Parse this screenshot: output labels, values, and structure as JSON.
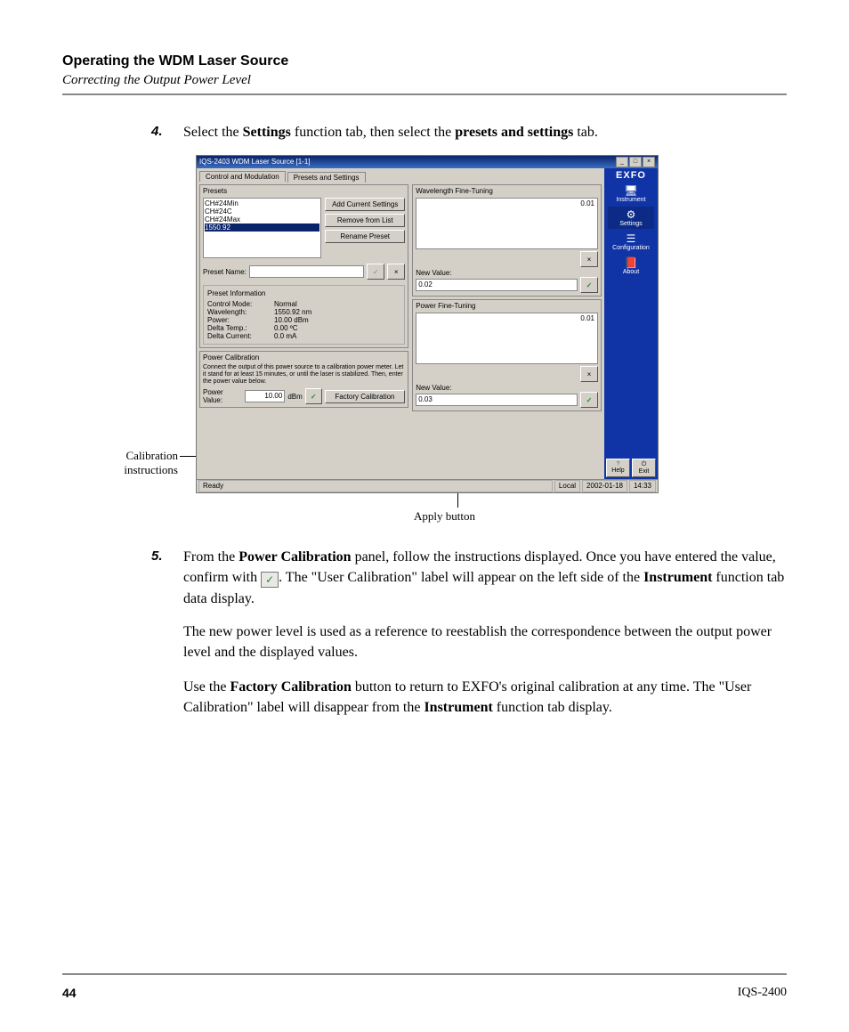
{
  "header": {
    "title": "Operating the WDM Laser Source",
    "subtitle": "Correcting the Output Power Level"
  },
  "step4": {
    "num": "4.",
    "t1": "Select the ",
    "b1": "Settings",
    "t2": " function tab, then select the ",
    "b2": "presets and settings",
    "t3": " tab."
  },
  "callouts": {
    "left1": "Calibration",
    "left2": "instructions",
    "bottom": "Apply button"
  },
  "window": {
    "title": "IQS-2403 WDM Laser Source [1-1]",
    "tabs": {
      "a": "Control and Modulation",
      "b": "Presets and Settings"
    },
    "presets": {
      "label": "Presets",
      "items": [
        "CH#24Min",
        "CH#24C",
        "CH#24Max",
        "1550.92"
      ],
      "add": "Add Current Settings",
      "remove": "Remove from List",
      "rename": "Rename Preset",
      "name_label": "Preset Name:"
    },
    "info": {
      "legend": "Preset Information",
      "l1": "Control Mode:",
      "v1": "Normal",
      "l2": "Wavelength:",
      "v2": "1550.92 nm",
      "l3": "Power:",
      "v3": "10.00 dBm",
      "l4": "Delta Temp.:",
      "v4": "0.00 ºC",
      "l5": "Delta Current:",
      "v5": "0.0 mA"
    },
    "wave": {
      "title": "Wavelength Fine-Tuning",
      "val": "0.01",
      "nv_label": "New Value:",
      "nv": "0.02"
    },
    "power": {
      "title": "Power Fine-Tuning",
      "val": "0.01",
      "nv_label": "New Value:",
      "nv": "0.03"
    },
    "cal": {
      "title": "Power Calibration",
      "text": "Connect the output of this power source to a calibration power meter. Let it stand for at least 15 minutes, or until the laser is stabilized. Then, enter the power value below.",
      "pv_label": "Power Value:",
      "pv": "10.00",
      "unit": "dBm",
      "factory": "Factory Calibration"
    },
    "side": {
      "logo": "EXFO",
      "instrument": "Instrument",
      "settings": "Settings",
      "configuration": "Configuration",
      "about": "About",
      "help": "Help",
      "exit": "Exit"
    },
    "status": {
      "ready": "Ready",
      "local": "Local",
      "date": "2002-01-18",
      "time": "14:33"
    }
  },
  "step5": {
    "num": "5.",
    "t1": "From the ",
    "b1": "Power Calibration",
    "t2": " panel, follow the instructions displayed. Once you have entered the value, confirm with ",
    "t3": ". The \"User Calibration\" label will appear on the left side of the ",
    "b2": "Instrument",
    "t4": " function tab data display."
  },
  "p6": "The new power level is used as a reference to reestablish the correspondence between the output power level and the displayed values.",
  "p7": {
    "t1": "Use the ",
    "b1": "Factory Calibration",
    "t2": " button to return to EXFO's original calibration at any time. The \"User Calibration\" label will disappear from the ",
    "b2": "Instrument",
    "t3": " function tab display."
  },
  "footer": {
    "page": "44",
    "doc": "IQS-2400"
  }
}
